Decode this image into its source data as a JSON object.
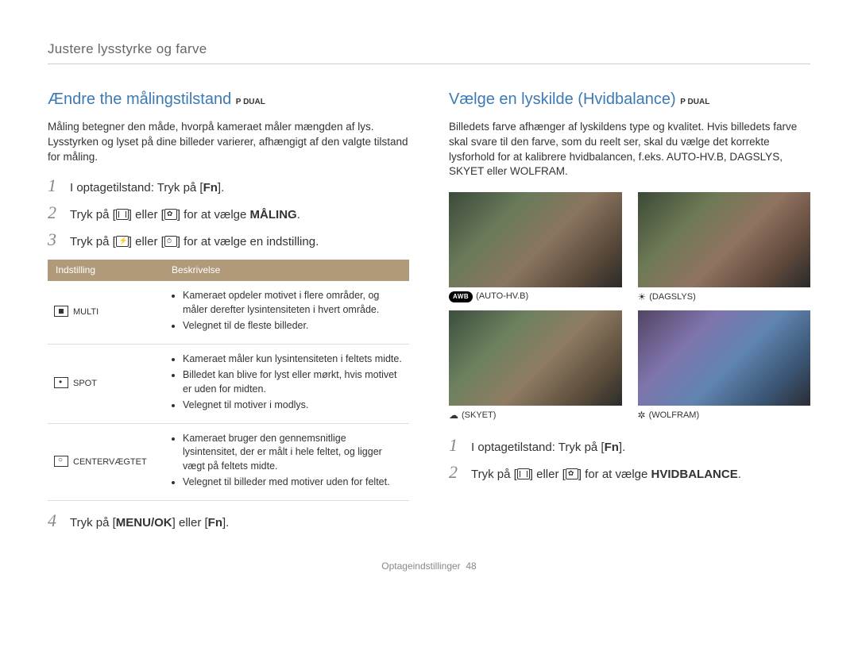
{
  "header": {
    "title": "Justere lysstyrke og farve"
  },
  "left": {
    "heading": "Ændre the målingstilstand",
    "mode_badge": "P  DUAL",
    "intro": "Måling betegner den måde, hvorpå kameraet måler mængden af lys. Lysstyrken og lyset på dine billeder varierer, afhængigt af den valgte tilstand for måling.",
    "steps": [
      {
        "n": "1",
        "pre": "I optagetilstand: Tryk på [",
        "key": "Fn",
        "post": "]."
      },
      {
        "n": "2",
        "pre": "Tryk på [",
        "mid": "] eller [",
        "post": "] for at vælge ",
        "bold": "MÅLING",
        "end": "."
      },
      {
        "n": "3",
        "pre": "Tryk på [",
        "mid": "] eller [",
        "post": "] for at vælge en indstilling."
      }
    ],
    "table": {
      "head": {
        "c1": "Indstilling",
        "c2": "Beskrivelse"
      },
      "rows": [
        {
          "name": "MULTI",
          "bullets": [
            "Kameraet opdeler motivet i flere områder, og måler derefter lysintensiteten i hvert område.",
            "Velegnet til de fleste billeder."
          ]
        },
        {
          "name": "SPOT",
          "bullets": [
            "Kameraet måler kun lysintensiteten i feltets midte.",
            "Billedet kan blive for lyst eller mørkt, hvis motivet er uden for midten.",
            "Velegnet til motiver i modlys."
          ]
        },
        {
          "name": "CENTERVÆGTET",
          "bullets": [
            "Kameraet bruger den gennemsnitlige lysintensitet, der er målt i hele feltet, og ligger vægt på feltets midte.",
            "Velegnet til billeder med motiver uden for feltet."
          ]
        }
      ]
    },
    "step4": {
      "n": "4",
      "pre": "Tryk på [",
      "key1": "MENU/OK",
      "mid": "] eller [",
      "key2": "Fn",
      "post": "]."
    }
  },
  "right": {
    "heading": "Vælge en lyskilde (Hvidbalance)",
    "mode_badge": "P  DUAL",
    "intro": "Billedets farve afhænger af lyskildens type og kvalitet. Hvis billedets farve skal svare til den farve, som du reelt ser, skal du vælge det korrekte lysforhold for at kalibrere hvidbalancen, f.eks. AUTO-HV.B, DAGSLYS, SKYET eller WOLFRAM.",
    "wb": [
      {
        "label": "(AUTO-HV.B)",
        "badge": "AWB"
      },
      {
        "label": "(DAGSLYS)",
        "icon": "☀"
      },
      {
        "label": "(SKYET)",
        "icon": "☁"
      },
      {
        "label": "(WOLFRAM)",
        "icon": "✲"
      }
    ],
    "steps": [
      {
        "n": "1",
        "pre": "I optagetilstand: Tryk på [",
        "key": "Fn",
        "post": "]."
      },
      {
        "n": "2",
        "pre": "Tryk på [",
        "mid": "] eller [",
        "post": "] for at vælge ",
        "bold": "HVIDBALANCE",
        "end": "."
      }
    ]
  },
  "footer": {
    "section": "Optageindstillinger",
    "page": "48"
  }
}
